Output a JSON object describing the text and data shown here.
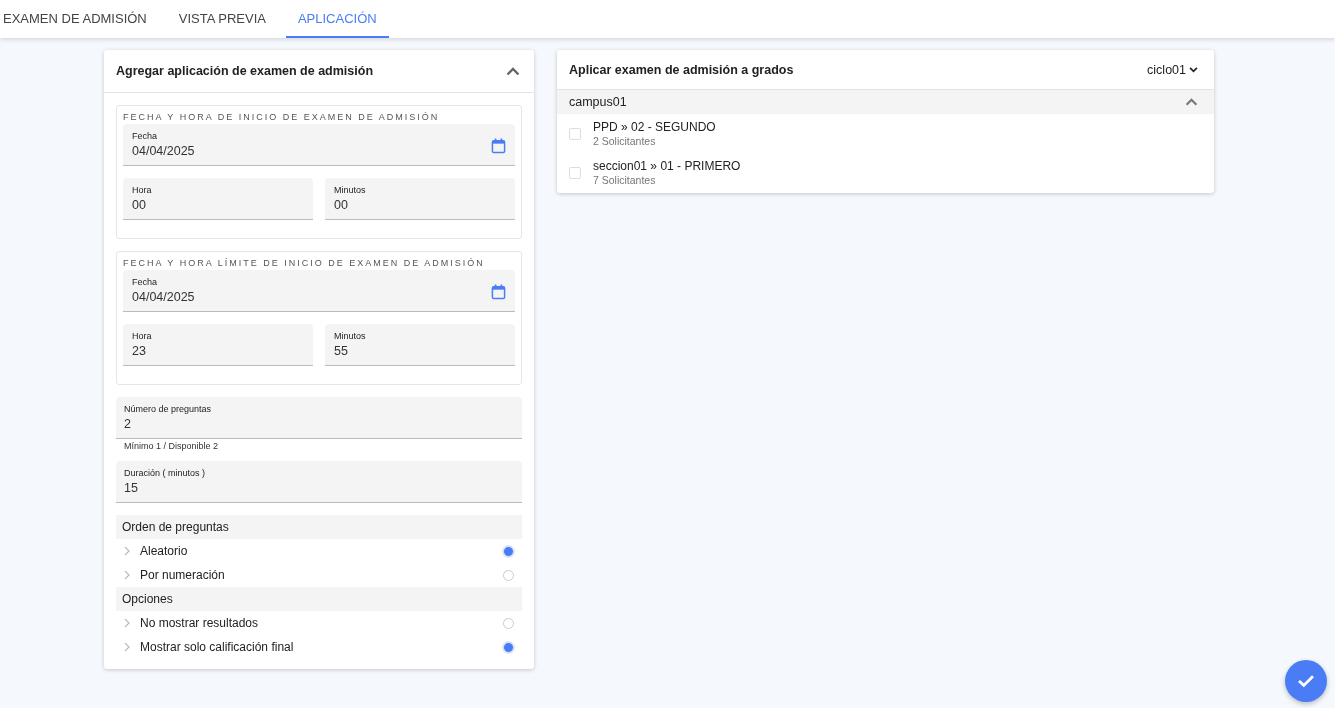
{
  "tabs": [
    {
      "label": "EXAMEN DE ADMISIÓN",
      "selected": false
    },
    {
      "label": "VISTA PREVIA",
      "selected": false
    },
    {
      "label": "APLICACIÓN",
      "selected": true
    }
  ],
  "form": {
    "title": "Agregar aplicación de examen de admisión",
    "expanded": true,
    "groups": [
      {
        "legend": "FECHA Y HORA DE INICIO DE EXAMEN DE ADMISIÓN",
        "date": {
          "label": "Fecha",
          "value": "04/04/2025"
        },
        "hour": {
          "label": "Hora",
          "value": "00"
        },
        "minutes": {
          "label": "Minutos",
          "value": "00"
        }
      },
      {
        "legend": "FECHA Y HORA LÍMITE DE INICIO DE EXAMEN DE ADMISIÓN",
        "date": {
          "label": "Fecha",
          "value": "04/04/2025"
        },
        "hour": {
          "label": "Hora",
          "value": "23"
        },
        "minutes": {
          "label": "Minutos",
          "value": "55"
        }
      }
    ],
    "fields": [
      {
        "label": "Número de preguntas",
        "value": "2",
        "hint": "Mínimo 1 / Disponible 2"
      },
      {
        "label": "Duración ( minutos )",
        "value": "15"
      }
    ],
    "radio_groups": [
      {
        "title": "Orden de preguntas",
        "options": [
          {
            "label": "Aleatorio",
            "selected": true
          },
          {
            "label": "Por numeración",
            "selected": false
          }
        ]
      },
      {
        "title": "Opciones",
        "options": [
          {
            "label": "No mostrar resultados",
            "selected": false
          },
          {
            "label": "Mostrar solo calificación final",
            "selected": true
          }
        ]
      }
    ]
  },
  "grades": {
    "title": "Aplicar examen de admisión a grados",
    "cycle": "ciclo01",
    "campuses": [
      {
        "name": "campus01",
        "expanded": true,
        "items": [
          {
            "name": "PPD » 02 - SEGUNDO",
            "applicants": "2 Solicitantes",
            "checked": false
          },
          {
            "name": "seccion01 » 01 - PRIMERO",
            "applicants": "7 Solicitantes",
            "checked": false
          }
        ]
      }
    ]
  }
}
